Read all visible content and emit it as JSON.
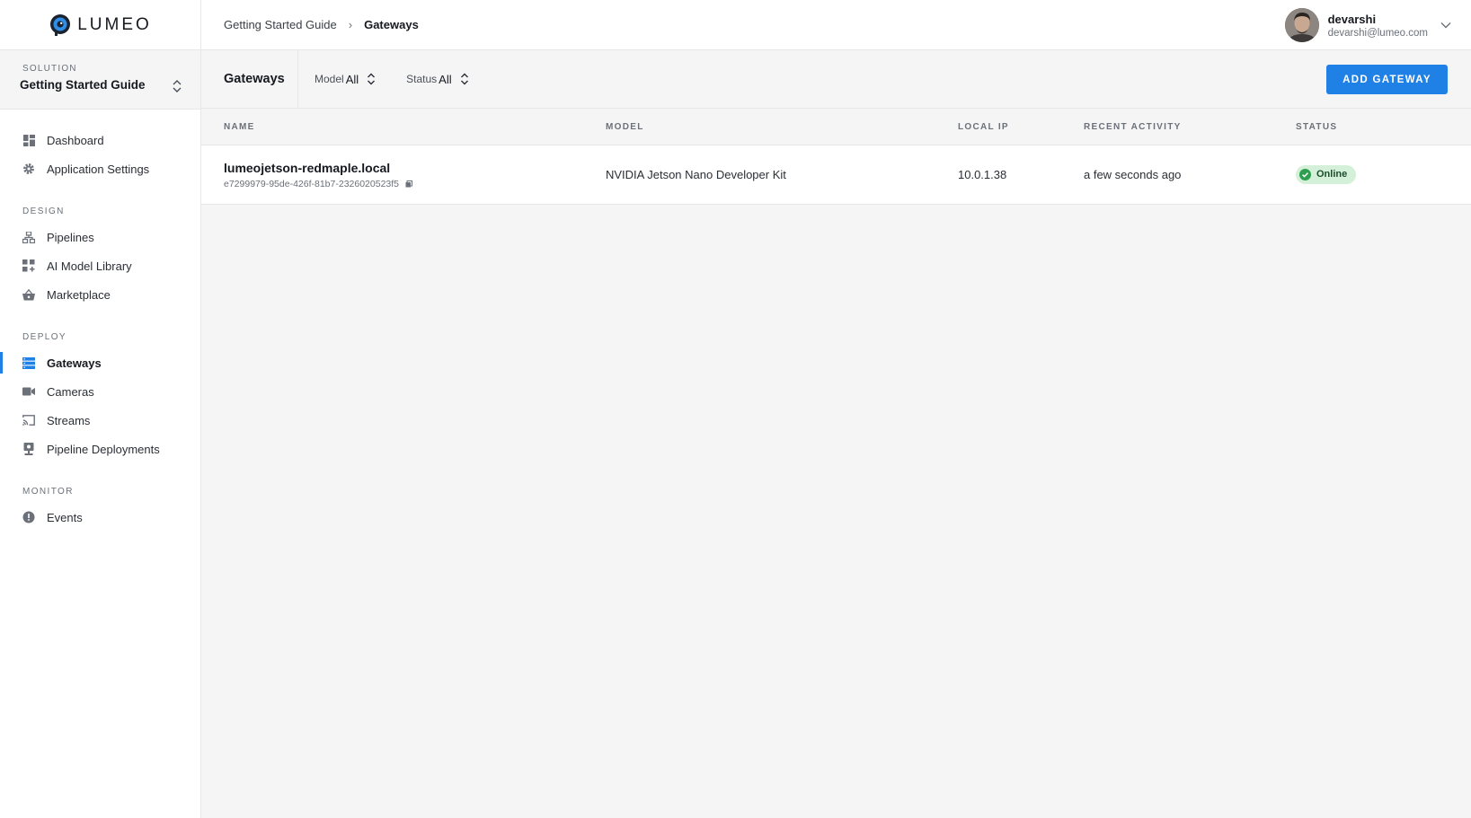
{
  "app": {
    "brand": "LUMEO",
    "accent_color": "#1f80e6"
  },
  "sidebar": {
    "solution_label": "SOLUTION",
    "solution_value": "Getting Started Guide",
    "top_items": [
      {
        "label": "Dashboard",
        "icon": "dashboard-icon"
      },
      {
        "label": "Application Settings",
        "icon": "gear-icon"
      }
    ],
    "design": {
      "heading": "DESIGN",
      "items": [
        {
          "label": "Pipelines",
          "icon": "pipelines-icon"
        },
        {
          "label": "AI Model Library",
          "icon": "model-library-icon"
        },
        {
          "label": "Marketplace",
          "icon": "basket-icon"
        }
      ]
    },
    "deploy": {
      "heading": "DEPLOY",
      "items": [
        {
          "label": "Gateways",
          "icon": "gateway-icon",
          "active": true
        },
        {
          "label": "Cameras",
          "icon": "camera-icon"
        },
        {
          "label": "Streams",
          "icon": "cast-icon"
        },
        {
          "label": "Pipeline Deployments",
          "icon": "deployment-icon"
        }
      ]
    },
    "monitor": {
      "heading": "MONITOR",
      "items": [
        {
          "label": "Events",
          "icon": "alert-circle-icon"
        }
      ]
    }
  },
  "header": {
    "breadcrumb": {
      "parent": "Getting Started Guide",
      "separator": "›",
      "current": "Gateways"
    },
    "user": {
      "name": "devarshi",
      "email": "devarshi@lumeo.com"
    }
  },
  "toolbar": {
    "title": "Gateways",
    "filters": {
      "model": {
        "label": "Model",
        "value": "All"
      },
      "status": {
        "label": "Status",
        "value": "All"
      }
    },
    "add_button": "ADD GATEWAY"
  },
  "table": {
    "columns": [
      "NAME",
      "MODEL",
      "LOCAL IP",
      "RECENT ACTIVITY",
      "STATUS"
    ],
    "rows": [
      {
        "name": "lumeojetson-redmaple.local",
        "id": "e7299979-95de-426f-81b7-2326020523f5",
        "model": "NVIDIA Jetson Nano Developer Kit",
        "local_ip": "10.0.1.38",
        "recent_activity": "a few seconds ago",
        "status": "Online",
        "status_color": "#2e9e4f"
      }
    ]
  }
}
